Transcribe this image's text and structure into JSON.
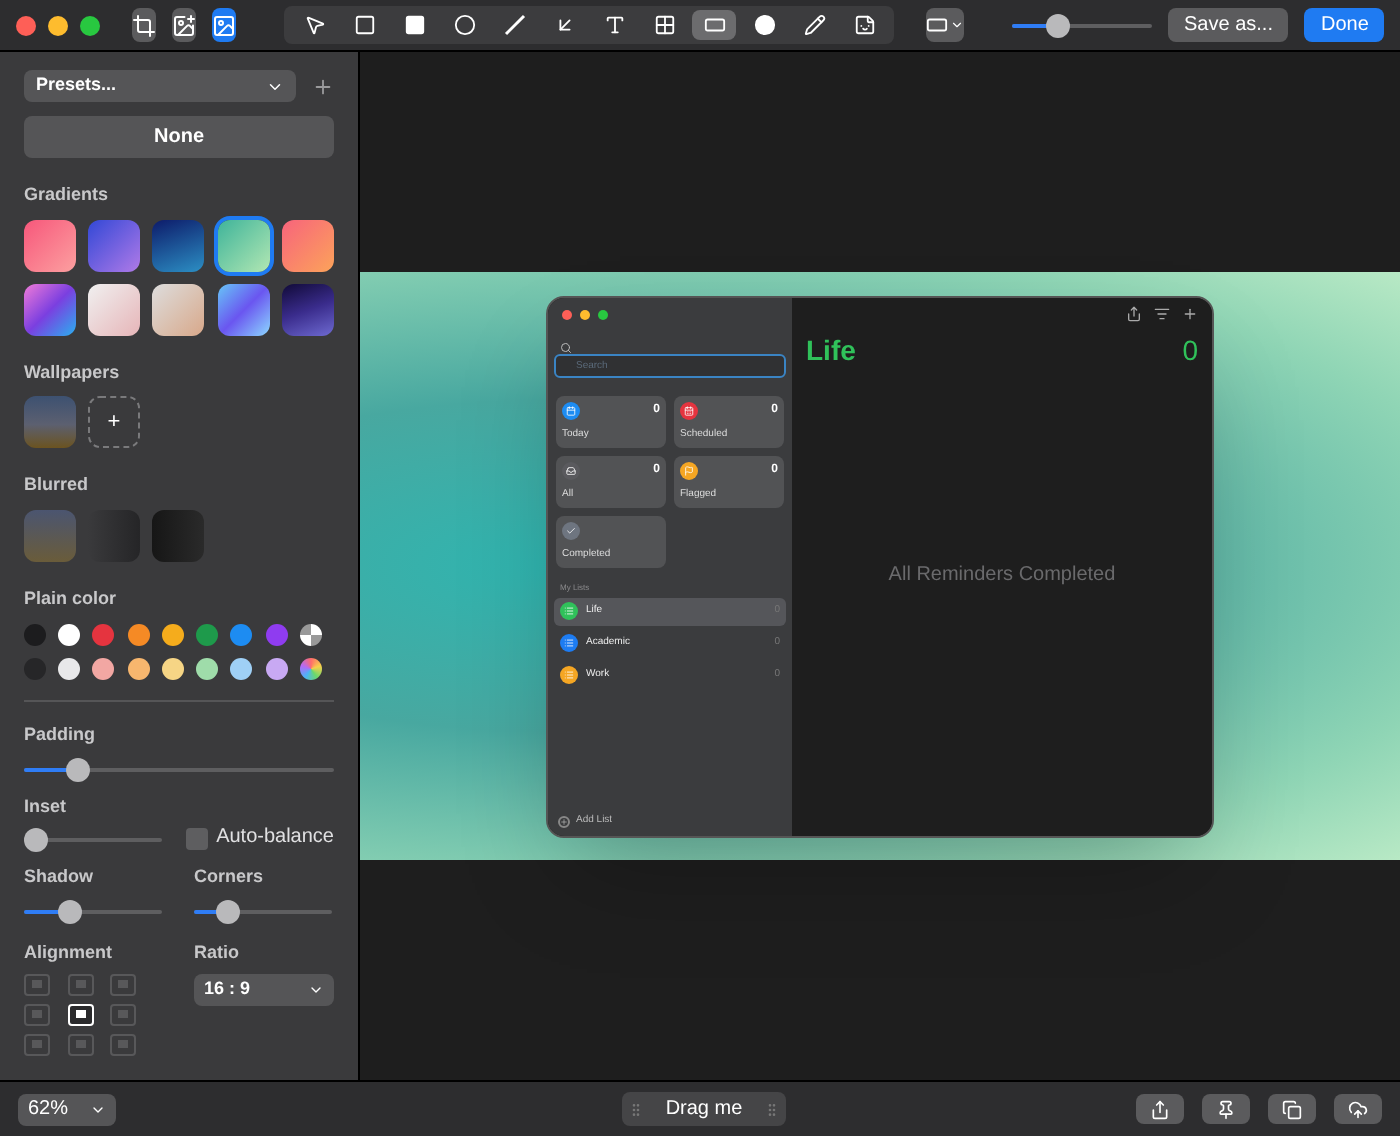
{
  "toolbar": {
    "left_tools": [
      {
        "kind": "crop",
        "selected": false
      },
      {
        "kind": "add-image",
        "selected": false
      },
      {
        "kind": "background",
        "selected": true
      }
    ],
    "tools": [
      {
        "kind": "pointer",
        "selected": false
      },
      {
        "kind": "rectangle",
        "selected": false
      },
      {
        "kind": "filled-rectangle",
        "selected": false
      },
      {
        "kind": "circle",
        "selected": false
      },
      {
        "kind": "line",
        "selected": false
      },
      {
        "kind": "arrow",
        "selected": false
      },
      {
        "kind": "text",
        "selected": false
      },
      {
        "kind": "pixelate",
        "selected": false
      },
      {
        "kind": "highlight",
        "selected": true
      },
      {
        "kind": "counter",
        "selected": false
      },
      {
        "kind": "pencil",
        "selected": false
      },
      {
        "kind": "sticker",
        "selected": false
      }
    ],
    "stroke": {
      "level": 0.3
    },
    "save": "Save as...",
    "done": "Done"
  },
  "sidebar": {
    "presets": "Presets...",
    "none": "None",
    "gradients_label": "Gradients",
    "gradients": [
      {
        "selected": false
      },
      {
        "selected": false
      },
      {
        "selected": false
      },
      {
        "selected": true
      },
      {
        "selected": false
      },
      {
        "selected": false
      },
      {
        "selected": false
      },
      {
        "selected": false
      },
      {
        "selected": false
      },
      {
        "selected": false
      }
    ],
    "wallpapers_label": "Wallpapers",
    "add": "+",
    "blurred_label": "Blurred",
    "plain_label": "Plain color",
    "colors": [
      {
        "kind": "solid",
        "color": "#1c1c1e"
      },
      {
        "kind": "solid",
        "color": "#ffffff"
      },
      {
        "kind": "solid",
        "color": "#e5343f"
      },
      {
        "kind": "solid",
        "color": "#f58a25"
      },
      {
        "kind": "solid",
        "color": "#f5ac1c"
      },
      {
        "kind": "solid",
        "color": "#1e9a4b"
      },
      {
        "kind": "solid",
        "color": "#1d8cf2"
      },
      {
        "kind": "solid",
        "color": "#8f3cf0"
      },
      {
        "kind": "transparent"
      },
      {
        "kind": "solid",
        "color": "#262628"
      },
      {
        "kind": "solid",
        "color": "#e8e8ea"
      },
      {
        "kind": "solid",
        "color": "#f2a7a3"
      },
      {
        "kind": "solid",
        "color": "#f7b66e"
      },
      {
        "kind": "solid",
        "color": "#f6d585"
      },
      {
        "kind": "solid",
        "color": "#9fdcaa"
      },
      {
        "kind": "solid",
        "color": "#9fd0f6"
      },
      {
        "kind": "solid",
        "color": "#c8a9f3"
      },
      {
        "kind": "rainbow"
      }
    ],
    "padding": {
      "label": "Padding",
      "level": 0.15
    },
    "inset": {
      "label": "Inset",
      "level": 0.0
    },
    "auto_balance": {
      "label": "Auto-balance",
      "checked": false
    },
    "shadow": {
      "label": "Shadow",
      "level": 0.3
    },
    "corners": {
      "label": "Corners",
      "level": 0.2
    },
    "alignment_label": "Alignment",
    "alignment": [
      {
        "selected": false
      },
      {
        "selected": false
      },
      {
        "selected": false
      },
      {
        "selected": false
      },
      {
        "selected": true
      },
      {
        "selected": false
      },
      {
        "selected": false
      },
      {
        "selected": false
      },
      {
        "selected": false
      }
    ],
    "ratio_label": "Ratio",
    "ratio": "16 : 9"
  },
  "reminders": {
    "search_placeholder": "Search",
    "smart_lists": [
      {
        "kind": "today",
        "name": "Today",
        "count": "0",
        "color": "#1d8cf2"
      },
      {
        "kind": "scheduled",
        "name": "Scheduled",
        "count": "0",
        "color": "#e5343f"
      },
      {
        "kind": "all",
        "name": "All",
        "count": "0",
        "color": "#5a5a5e"
      },
      {
        "kind": "flagged",
        "name": "Flagged",
        "count": "0",
        "color": "#f5a623"
      },
      {
        "kind": "completed",
        "name": "Completed",
        "color": "#6e7580"
      }
    ],
    "my_lists_label": "My Lists",
    "lists": [
      {
        "name": "Life",
        "count": "0",
        "color": "#30c15a",
        "selected": true
      },
      {
        "name": "Academic",
        "count": "0",
        "color": "#1d7cf2",
        "selected": false
      },
      {
        "name": "Work",
        "count": "0",
        "color": "#f5a623",
        "selected": false
      }
    ],
    "add_list": "Add List",
    "title": "Life",
    "title_count": "0",
    "empty": "All Reminders Completed"
  },
  "bottom": {
    "zoom": "62%",
    "drag": "Drag me"
  }
}
